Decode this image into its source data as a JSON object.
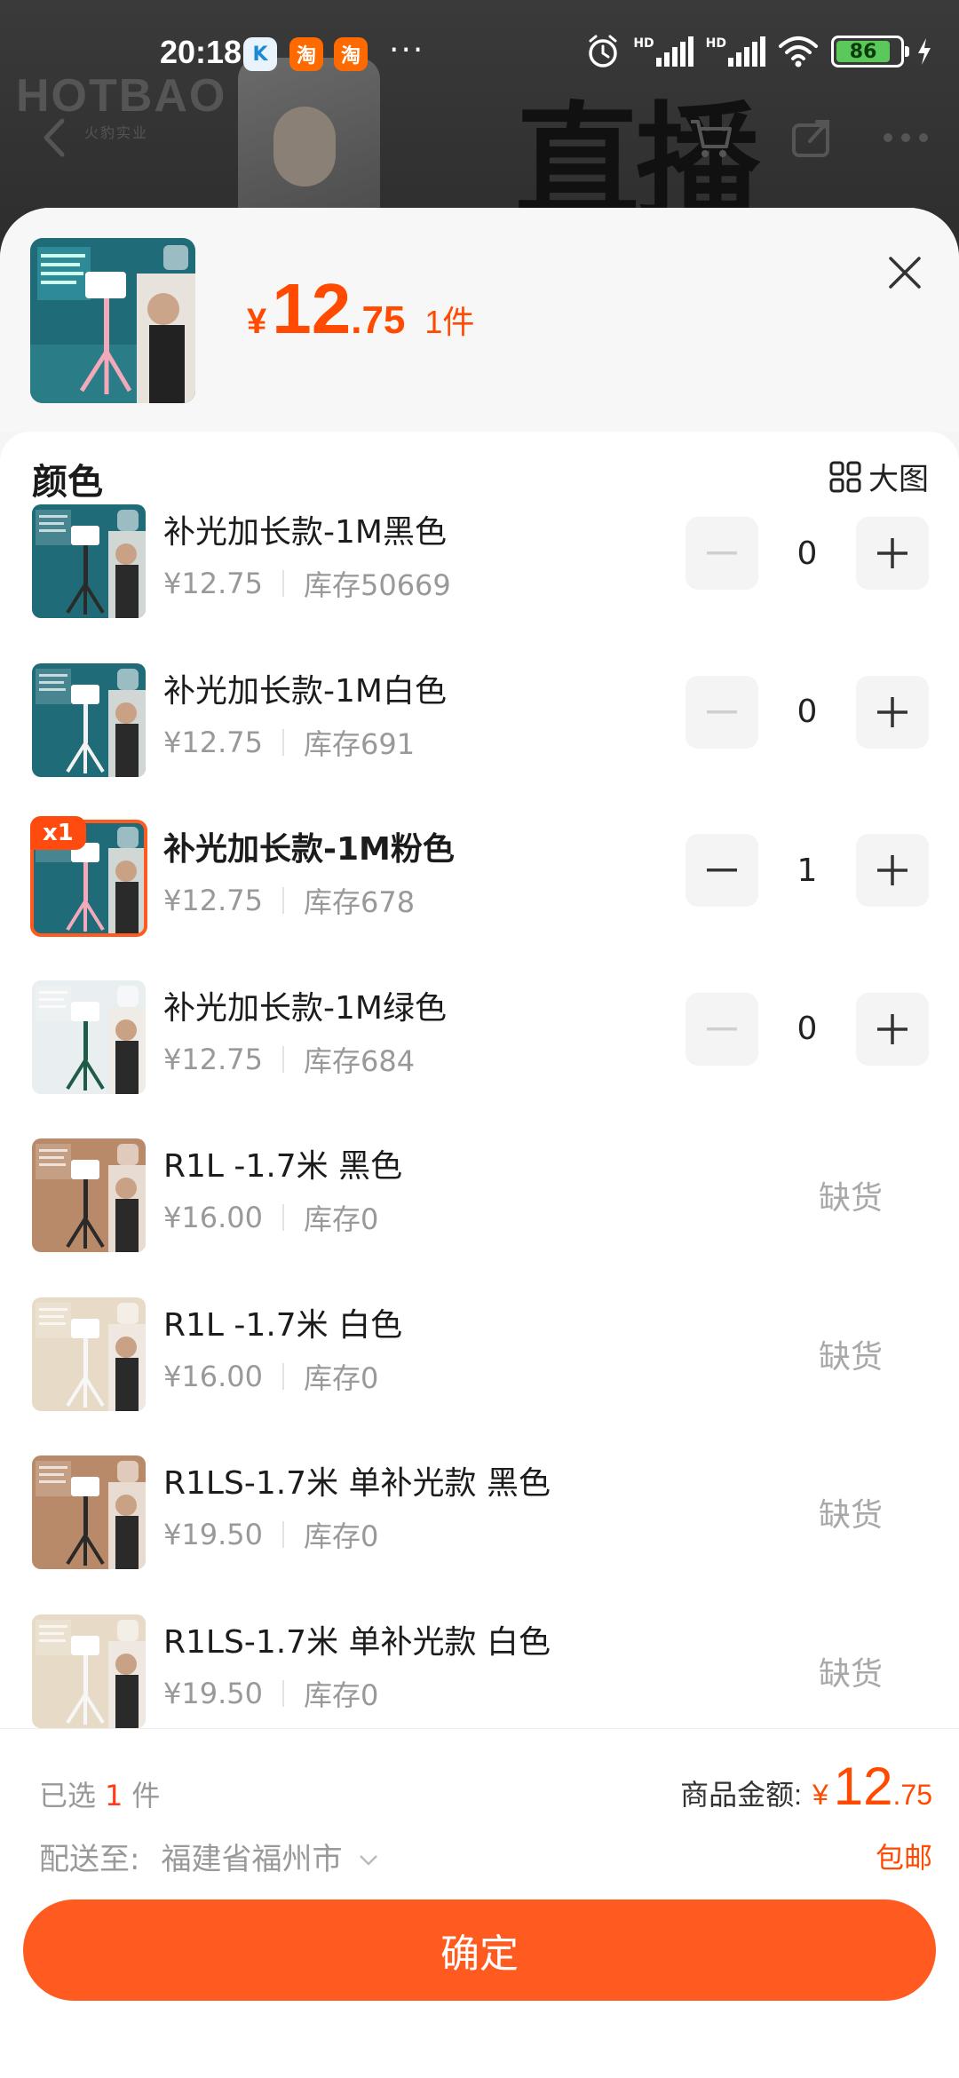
{
  "status_bar": {
    "time": "20:18",
    "app_icons": [
      "K",
      "淘",
      "淘"
    ],
    "more": "···",
    "network": "HD",
    "battery": "86"
  },
  "background": {
    "brand": "HOTBAO",
    "brand_sub": "火豹实业",
    "hero_text": "直播"
  },
  "sheet": {
    "price_yen": "¥",
    "price_int": "12",
    "price_dec": ".75",
    "qty": "1件",
    "section_title": "颜色",
    "big_image_label": "大图"
  },
  "skus": [
    {
      "name": "补光加长款-1M黑色",
      "price": "¥12.75",
      "stock": "库存50669",
      "qty": "0",
      "available": true,
      "selected": false,
      "thumb_colors": [
        "#1f6b78",
        "#2b2b2b"
      ]
    },
    {
      "name": "补光加长款-1M白色",
      "price": "¥12.75",
      "stock": "库存691",
      "qty": "0",
      "available": true,
      "selected": false,
      "thumb_colors": [
        "#1f6b78",
        "#f2f2f2"
      ]
    },
    {
      "name": "补光加长款-1M粉色",
      "price": "¥12.75",
      "stock": "库存678",
      "qty": "1",
      "available": true,
      "selected": true,
      "badge": "x1",
      "thumb_colors": [
        "#1f6b78",
        "#f3a9b9"
      ]
    },
    {
      "name": "补光加长款-1M绿色",
      "price": "¥12.75",
      "stock": "库存684",
      "qty": "0",
      "available": true,
      "selected": false,
      "thumb_colors": [
        "#e9eef0",
        "#1f5c47"
      ]
    },
    {
      "name": "R1L -1.7米 黑色",
      "price": "¥16.00",
      "stock": "库存0",
      "status": "缺货",
      "available": false,
      "thumb_colors": [
        "#b98a6a",
        "#2a2a2a"
      ]
    },
    {
      "name": "R1L -1.7米 白色",
      "price": "¥16.00",
      "stock": "库存0",
      "status": "缺货",
      "available": false,
      "thumb_colors": [
        "#e7dbc7",
        "#f7f7f7"
      ]
    },
    {
      "name": "R1LS-1.7米 单补光款 黑色",
      "price": "¥19.50",
      "stock": "库存0",
      "status": "缺货",
      "available": false,
      "thumb_colors": [
        "#b98a6a",
        "#2a2a2a"
      ]
    },
    {
      "name": "R1LS-1.7米 单补光款 白色",
      "price": "¥19.50",
      "stock": "库存0",
      "status": "缺货",
      "available": false,
      "thumb_colors": [
        "#e7dbc7",
        "#f7f7f7"
      ]
    }
  ],
  "footer": {
    "selected_prefix": "已选",
    "selected_count": "1",
    "selected_suffix": "件",
    "total_label": "商品金额:",
    "total_yen": "¥",
    "total_int": "12",
    "total_dec": ".75",
    "ship_label": "配送至:",
    "ship_address": "福建省福州市",
    "free_shipping": "包邮",
    "confirm": "确定"
  },
  "colors": {
    "accent": "#ff5a1f",
    "price": "#ff4a00"
  }
}
